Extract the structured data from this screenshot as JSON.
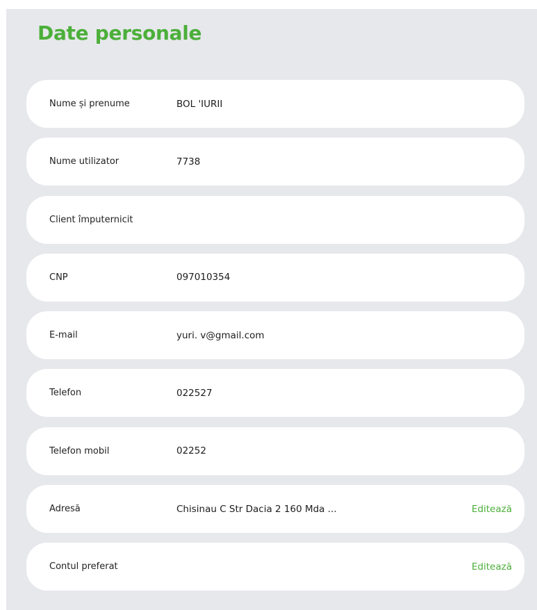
{
  "page": {
    "title": "Date personale"
  },
  "fields": [
    {
      "label": "Nume și prenume",
      "value": "BOL      'IURII",
      "action": ""
    },
    {
      "label": "Nume utilizator",
      "value": "7738",
      "action": ""
    },
    {
      "label": "Client împuternicit",
      "value": "",
      "action": ""
    },
    {
      "label": "CNP",
      "value": "097010354",
      "action": ""
    },
    {
      "label": "E-mail",
      "value": "yuri.          v@gmail.com",
      "action": ""
    },
    {
      "label": "Telefon",
      "value": "022527",
      "action": ""
    },
    {
      "label": "Telefon mobil",
      "value": "02252",
      "action": ""
    },
    {
      "label": "Adresă",
      "value": "Chisinau C Str Dacia           2 160 Mda ...",
      "action": "Editează"
    },
    {
      "label": "Contul preferat",
      "value": "",
      "action": "Editează"
    }
  ],
  "colors": {
    "accent": "#4caf3a",
    "panel_background": "#e7e8ec",
    "row_background": "#ffffff"
  }
}
